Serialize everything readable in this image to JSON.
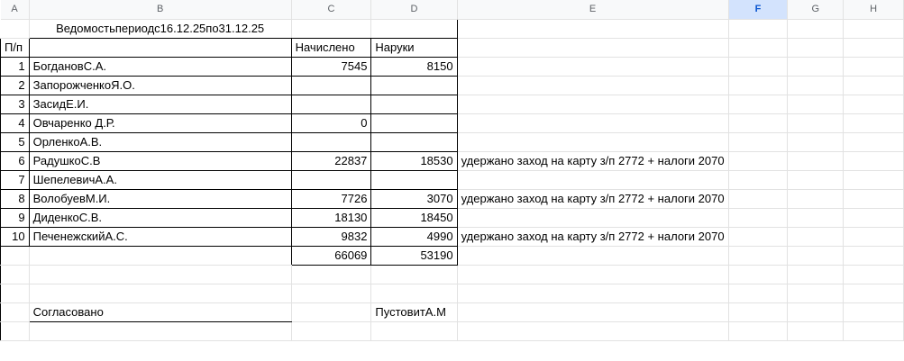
{
  "columns": [
    "A",
    "B",
    "C",
    "D",
    "E",
    "F",
    "G",
    "H"
  ],
  "selected_column": "F",
  "title": "Ведомостьпериодс16.12.25по31.12.25",
  "headers": {
    "num": "П/п",
    "accrued": "Начислено",
    "cash": "Наруки"
  },
  "rows": [
    {
      "num": "1",
      "name": "БогдановС.А.",
      "accrued": "7545",
      "cash": "8150",
      "note": ""
    },
    {
      "num": "2",
      "name": "ЗапорожченкоЯ.О.",
      "accrued": "",
      "cash": "",
      "note": ""
    },
    {
      "num": "3",
      "name": "ЗасидЕ.И.",
      "accrued": "",
      "cash": "",
      "note": ""
    },
    {
      "num": "4",
      "name": "Овчаренко Д.Р.",
      "accrued": "0",
      "cash": "",
      "note": ""
    },
    {
      "num": "5",
      "name": "ОрленкоА.В.",
      "accrued": "",
      "cash": "",
      "note": ""
    },
    {
      "num": "6",
      "name": "РадушкоС.В",
      "accrued": "22837",
      "cash": "18530",
      "note": "удержано  заход на карту з/п 2772 + налоги 2070"
    },
    {
      "num": "7",
      "name": "ШепелевичА.А.",
      "accrued": "",
      "cash": "",
      "note": ""
    },
    {
      "num": "8",
      "name": "ВолобуевМ.И.",
      "accrued": "7726",
      "cash": "3070",
      "note": "удержано  заход на карту з/п 2772 + налоги 2070"
    },
    {
      "num": "9",
      "name": "ДиденкоС.В.",
      "accrued": "18130",
      "cash": "18450",
      "note": ""
    },
    {
      "num": "10",
      "name": "ПеченежскийА.С.",
      "accrued": "9832",
      "cash": "4990",
      "note": "удержано  заход на карту з/п 2772 + налоги 2070"
    }
  ],
  "totals": {
    "accrued": "66069",
    "cash": "53190"
  },
  "footer": {
    "approved": "Согласовано",
    "signer": "ПустовитА.М"
  }
}
